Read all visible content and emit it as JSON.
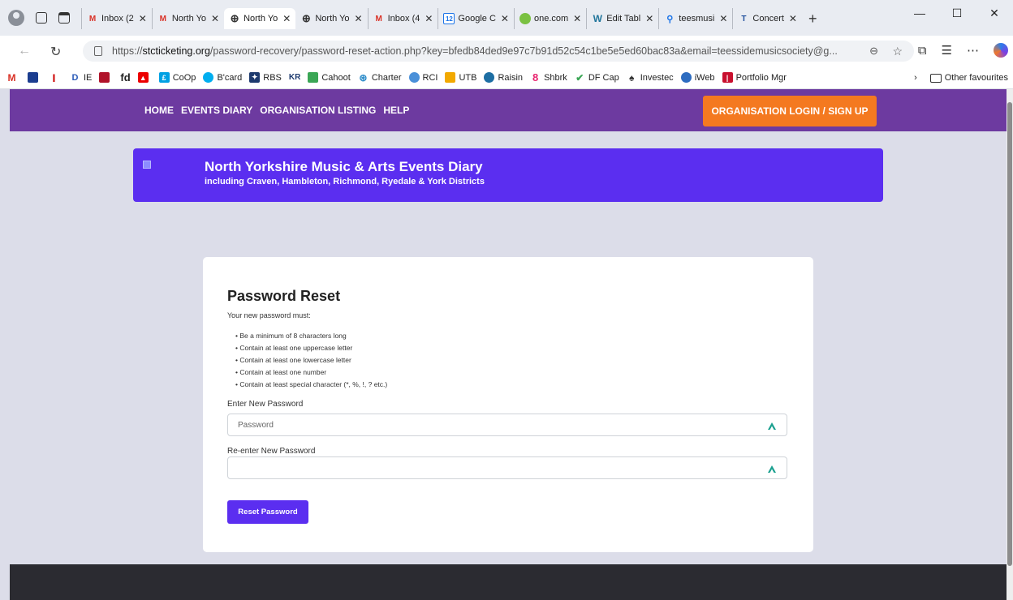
{
  "browser": {
    "tabs": [
      {
        "icon": "gmail-icon",
        "label": "Inbox (2",
        "active": false
      },
      {
        "icon": "gmail-icon",
        "label": "North Yo",
        "active": false
      },
      {
        "icon": "globe-icon",
        "label": "North Yo",
        "active": true
      },
      {
        "icon": "globe-icon",
        "label": "North Yo",
        "active": false
      },
      {
        "icon": "gmail-icon",
        "label": "Inbox (4",
        "active": false
      },
      {
        "icon": "calendar-icon",
        "label": "Google C",
        "active": false
      },
      {
        "icon": "onecom-icon",
        "label": "one.com",
        "active": false
      },
      {
        "icon": "wordpress-icon",
        "label": "Edit Tabl",
        "active": false
      },
      {
        "icon": "search-icon",
        "label": "teesmusi",
        "active": false
      },
      {
        "icon": "tm-icon",
        "label": "Concert",
        "active": false
      }
    ],
    "url": {
      "prefix": "https://",
      "domain": "stcticketing.org",
      "path": "/password-recovery/password-reset-action.php?key=bfedb84ded9e97c7b91d52c54c1be5e5ed60bac83a&email=teessidemusicsociety@g..."
    },
    "bookmarks": [
      {
        "label": "",
        "icon": "gmail-icon"
      },
      {
        "label": "",
        "icon": "flag-icon"
      },
      {
        "label": "",
        "icon": "times-icon"
      },
      {
        "label": "IE",
        "icon": "ie-icon"
      },
      {
        "label": "",
        "icon": "app-icon"
      },
      {
        "label": "fd",
        "icon": ""
      },
      {
        "label": "",
        "icon": "santander-icon"
      },
      {
        "label": "CoOp",
        "icon": "coop-icon"
      },
      {
        "label": "B'card",
        "icon": "barclaycard-icon"
      },
      {
        "label": "RBS",
        "icon": "rbs-icon"
      },
      {
        "label": "",
        "icon": "kr-icon"
      },
      {
        "label": "Cahoot",
        "icon": "cahoot-icon"
      },
      {
        "label": "Charter",
        "icon": "charter-icon"
      },
      {
        "label": "RCI",
        "icon": "rci-icon"
      },
      {
        "label": "UTB",
        "icon": "utb-icon"
      },
      {
        "label": "Raisin",
        "icon": "raisin-icon"
      },
      {
        "label": "Shbrk",
        "icon": "shbrk-icon"
      },
      {
        "label": "DF Cap",
        "icon": "dfcap-icon"
      },
      {
        "label": "Investec",
        "icon": "investec-icon"
      },
      {
        "label": "iWeb",
        "icon": "iweb-icon"
      },
      {
        "label": "Portfolio Mgr",
        "icon": "portfolio-icon"
      }
    ],
    "other_favourites": "Other favourites"
  },
  "site": {
    "nav": [
      "HOME",
      "EVENTS DIARY",
      "ORGANISATION LISTING",
      "HELP"
    ],
    "login_label": "ORGANISATION LOGIN / SIGN UP",
    "banner_title": "North Yorkshire Music & Arts Events Diary",
    "banner_subtitle": "including Craven, Hambleton, Richmond, Ryedale & York Districts"
  },
  "form": {
    "title": "Password Reset",
    "intro": "Your new password must:",
    "rules": [
      "Be a minimum of 8 characters long",
      "Contain at least one uppercase letter",
      "Contain at least one lowercase letter",
      "Contain at least one number",
      "Contain at least special character (*, %, !, ? etc.)"
    ],
    "new_label": "Enter New Password",
    "new_placeholder": "Password",
    "confirm_label": "Re-enter New Password",
    "confirm_placeholder": "",
    "submit_label": "Reset Password"
  },
  "colors": {
    "header": "#6d3aa0",
    "banner": "#5b2ef0",
    "login_button": "#f47920",
    "primary_button": "#5b2ef0",
    "footer": "#2b2b31"
  }
}
